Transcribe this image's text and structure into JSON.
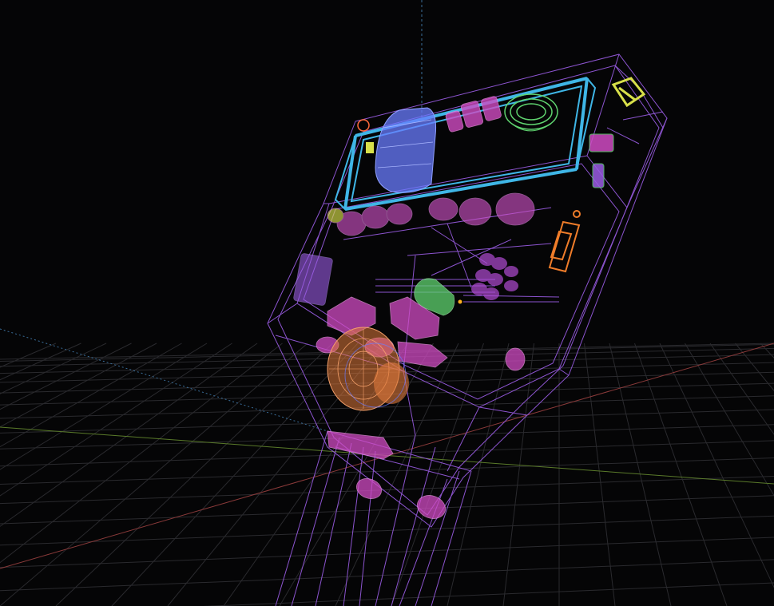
{
  "viewport": {
    "background": "#050506",
    "grid_color": "#2a2a2e",
    "x_axis_color": "#8a3a3a",
    "y_axis_color": "#5a7a2a",
    "z_axis_color": "#3a6e9a"
  },
  "model": {
    "wire_color": "#9b5de5",
    "materials": {
      "housing": "#9b5de5",
      "display_frame": "#3fb6e6",
      "battery": "#6a7cff",
      "speaker": "#e07a3c",
      "buttons": "#d04bc2",
      "green_parts": "#5fd36f",
      "yellow_parts": "#d8e04a",
      "orange_case": "#f07d2a"
    }
  }
}
